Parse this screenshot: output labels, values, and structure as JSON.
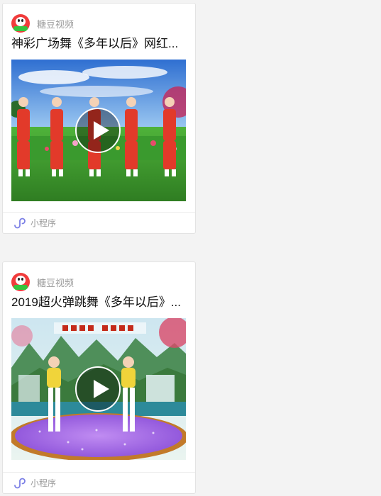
{
  "cards": [
    {
      "app_name": "糖豆视频",
      "app_icon": "tangdou-logo-icon",
      "title": "神彩广场舞《多年以后》网红...",
      "footer_label": "小程序",
      "footer_icon": "mini-program-icon"
    },
    {
      "app_name": "糖豆视频",
      "app_icon": "tangdou-logo-icon",
      "title": "2019超火弹跳舞《多年以后》...",
      "footer_label": "小程序",
      "footer_icon": "mini-program-icon"
    }
  ],
  "colors": {
    "background": "#f3f3f3",
    "card": "#ffffff",
    "muted_text": "#9a9a9a",
    "brand_red": "#f13c3c",
    "mini_program_accent": "#7b7fe6"
  }
}
